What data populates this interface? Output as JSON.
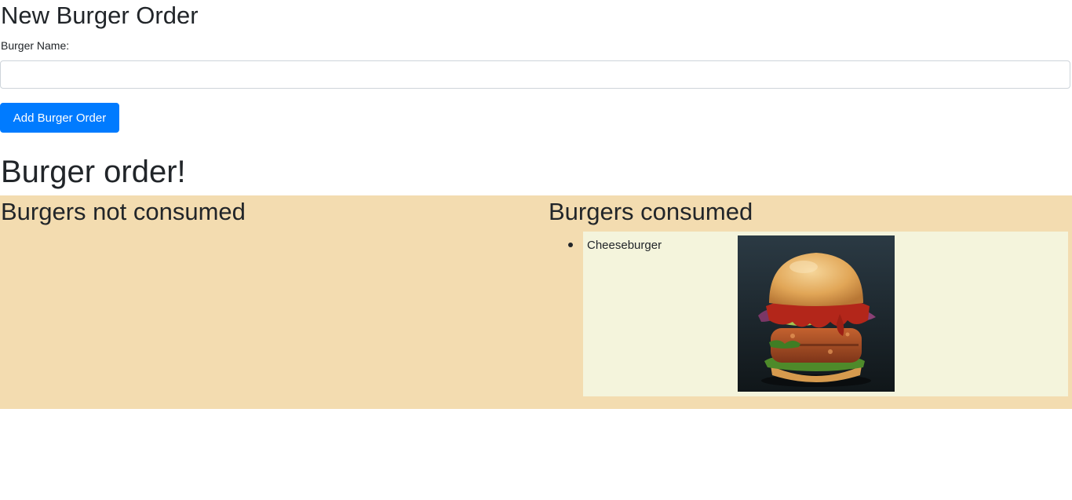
{
  "form": {
    "title": "New Burger Order",
    "name_label": "Burger Name:",
    "name_value": "",
    "name_placeholder": "",
    "submit_label": "Add Burger Order"
  },
  "page_heading": "Burger order!",
  "columns": {
    "not_consumed": {
      "title": "Burgers not consumed",
      "items": []
    },
    "consumed": {
      "title": "Burgers consumed",
      "items": [
        {
          "name": "Cheeseburger",
          "image": "burger-photo"
        }
      ]
    }
  },
  "colors": {
    "primary": "#007bff",
    "board_bg": "#f3dcb0",
    "list_bg": "#f4f4dc",
    "text": "#212529"
  }
}
